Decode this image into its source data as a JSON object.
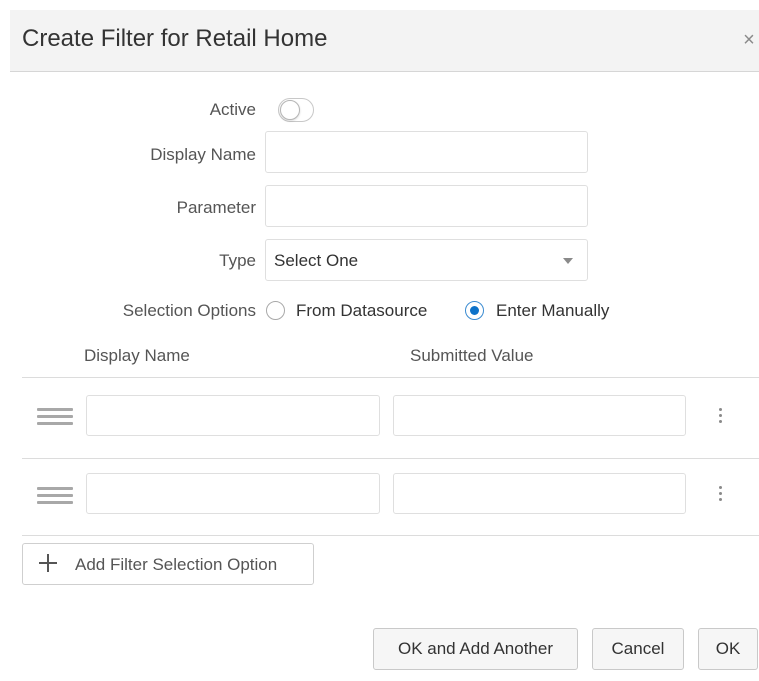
{
  "dialog": {
    "title": "Create Filter for Retail Home",
    "close_glyph": "×"
  },
  "form": {
    "active_label": "Active",
    "active_on": false,
    "display_name_label": "Display Name",
    "display_name_value": "",
    "parameter_label": "Parameter",
    "parameter_value": "",
    "type_label": "Type",
    "type_value": "Select One",
    "selection_options_label": "Selection Options",
    "selection_options": [
      {
        "label": "From Datasource",
        "selected": false
      },
      {
        "label": "Enter Manually",
        "selected": true
      }
    ]
  },
  "options_table": {
    "columns": [
      "Display Name",
      "Submitted Value"
    ],
    "rows": [
      {
        "display_name": "",
        "submitted_value": ""
      },
      {
        "display_name": "",
        "submitted_value": ""
      }
    ],
    "add_label": "Add Filter Selection Option"
  },
  "footer": {
    "ok_add_another_label": "OK and Add Another",
    "cancel_label": "Cancel",
    "ok_label": "OK"
  },
  "colors": {
    "accent": "#0d72c9",
    "header_bg": "#f3f3f3",
    "button_bg": "#f6f6f6"
  },
  "icons": [
    "close-icon",
    "drag-handle-icon",
    "more-options-icon",
    "plus-icon",
    "chevron-down-icon"
  ]
}
